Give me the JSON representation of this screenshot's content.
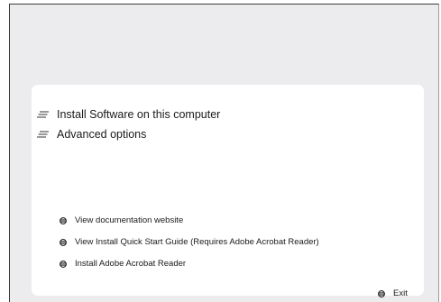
{
  "menu": {
    "items": [
      {
        "label": "Install Software on this computer",
        "icon": "lines-icon"
      },
      {
        "label": "Advanced options",
        "icon": "lines-icon"
      }
    ]
  },
  "links": {
    "items": [
      {
        "label": "View documentation website",
        "icon": "bullet-icon"
      },
      {
        "label": "View Install Quick Start Guide (Requires Adobe Acrobat Reader)",
        "icon": "bullet-icon"
      },
      {
        "label": "Install Adobe Acrobat Reader",
        "icon": "bullet-icon"
      }
    ]
  },
  "exit": {
    "label": "Exit",
    "icon": "bullet-icon"
  },
  "colors": {
    "window_background": "#ececee",
    "panel_background": "#ffffff",
    "text": "#1a1a1a"
  }
}
